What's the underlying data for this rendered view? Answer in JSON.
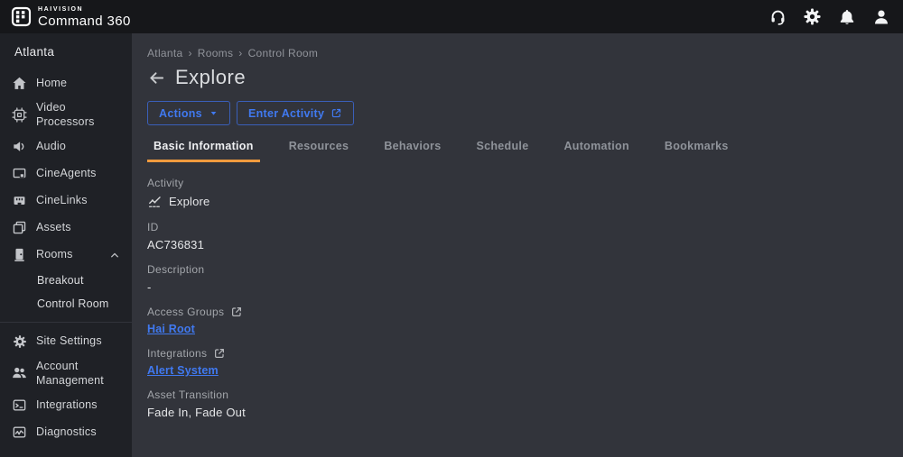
{
  "app": {
    "brand_line1": "HAIVISION",
    "brand_line2": "Command 360"
  },
  "topbar": {
    "icons": [
      "support-headset",
      "settings-gear",
      "notifications-bell",
      "account-person"
    ]
  },
  "sidebar": {
    "site_name": "Atlanta",
    "items": [
      {
        "label": "Home",
        "icon": "home-icon"
      },
      {
        "label": "Video Processors",
        "icon": "chip-icon"
      },
      {
        "label": "Audio",
        "icon": "speaker-icon"
      },
      {
        "label": "CineAgents",
        "icon": "screen-icon"
      },
      {
        "label": "CineLinks",
        "icon": "port-icon"
      },
      {
        "label": "Assets",
        "icon": "layers-icon"
      },
      {
        "label": "Rooms",
        "icon": "door-icon",
        "expanded": true,
        "children": [
          "Breakout",
          "Control Room"
        ]
      },
      {
        "label": "Site Settings",
        "icon": "gear-icon"
      },
      {
        "label": "Account Management",
        "icon": "people-icon"
      },
      {
        "label": "Integrations",
        "icon": "terminal-icon"
      },
      {
        "label": "Diagnostics",
        "icon": "pulse-icon"
      }
    ]
  },
  "main": {
    "breadcrumb": [
      "Atlanta",
      "Rooms",
      "Control Room"
    ],
    "breadcrumb_sep": "›",
    "title": "Explore",
    "buttons": {
      "actions": "Actions",
      "enter_activity": "Enter Activity"
    },
    "tabs": [
      {
        "label": "Basic Information",
        "active": true
      },
      {
        "label": "Resources",
        "active": false
      },
      {
        "label": "Behaviors",
        "active": false
      },
      {
        "label": "Schedule",
        "active": false
      },
      {
        "label": "Automation",
        "active": false
      },
      {
        "label": "Bookmarks",
        "active": false
      }
    ],
    "fields": {
      "activity": {
        "label": "Activity",
        "value": "Explore",
        "icon": "activity-chart-icon"
      },
      "id": {
        "label": "ID",
        "value": "AC736831"
      },
      "description": {
        "label": "Description",
        "value": "-"
      },
      "access_groups": {
        "label": "Access Groups",
        "link": "Hai Root",
        "icon": "external-link-icon"
      },
      "integrations": {
        "label": "Integrations",
        "link": "Alert System",
        "icon": "external-link-icon"
      },
      "asset_transition": {
        "label": "Asset Transition",
        "value": "Fade In, Fade Out"
      }
    }
  },
  "colors": {
    "accent_blue": "#4079f0",
    "tab_active_underline": "#f09a3e",
    "topbar_bg": "#16171a",
    "sidebar_bg": "#1f2126",
    "main_bg": "#32343b"
  }
}
